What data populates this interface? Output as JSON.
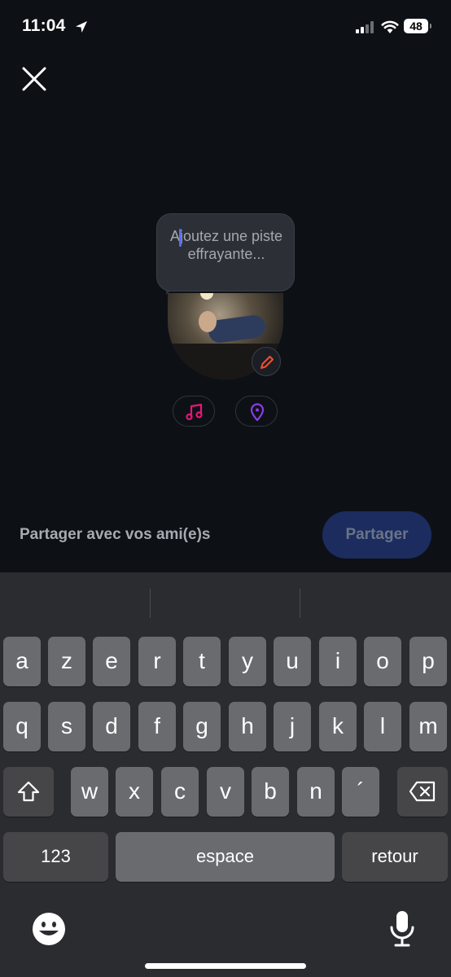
{
  "status": {
    "time": "11:04",
    "battery": "48"
  },
  "caption": {
    "placeholder": "Ajoutez une piste effrayante..."
  },
  "share": {
    "label": "Partager avec vos ami(e)s",
    "button": "Partager"
  },
  "keyboard": {
    "row1": [
      "a",
      "z",
      "e",
      "r",
      "t",
      "y",
      "u",
      "i",
      "o",
      "p"
    ],
    "row2": [
      "q",
      "s",
      "d",
      "f",
      "g",
      "h",
      "j",
      "k",
      "l",
      "m"
    ],
    "row3": [
      "w",
      "x",
      "c",
      "v",
      "b",
      "n",
      "´"
    ],
    "numbers_key": "123",
    "space_key": "espace",
    "return_key": "retour"
  },
  "icons": {
    "close": "close-icon",
    "music": "music-note-icon",
    "location": "location-pin-icon",
    "edit": "pencil-icon",
    "shift": "shift-icon",
    "delete": "backspace-icon",
    "emoji": "emoji-icon",
    "mic": "microphone-icon"
  },
  "colors": {
    "music_accent": "#e8157a",
    "location_accent": "#8b3bea",
    "edit_accent": "#f2502e",
    "share_button_bg": "#1c2c5f"
  }
}
